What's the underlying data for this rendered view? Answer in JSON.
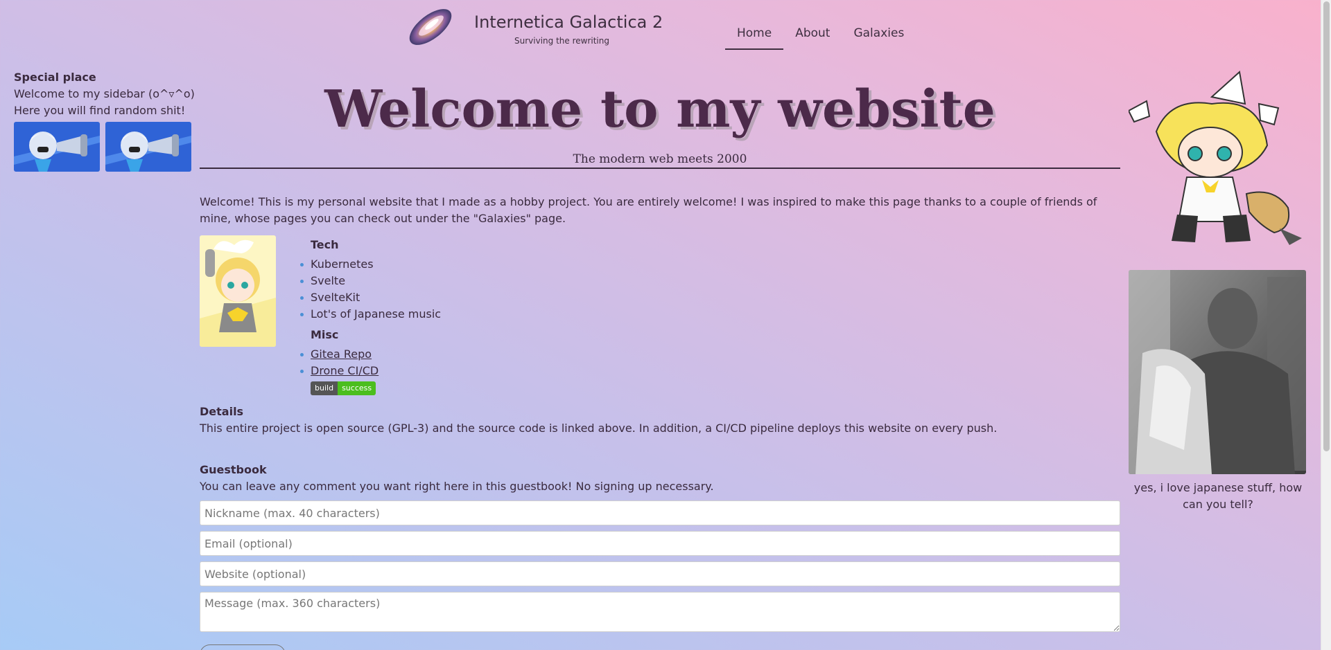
{
  "header": {
    "title": "Internetica Galactica 2",
    "subtitle": "Surviving the rewriting",
    "logo_icon": "galaxy-icon",
    "nav": [
      {
        "label": "Home",
        "active": true
      },
      {
        "label": "About",
        "active": false
      },
      {
        "label": "Galaxies",
        "active": false
      }
    ]
  },
  "left_sidebar": {
    "heading": "Special place",
    "line1": "Welcome to my sidebar (o^▿^o)",
    "line2": "Here you will find random shit!"
  },
  "main": {
    "title": "Welcome to my website",
    "subtitle": "The modern web meets 2000",
    "intro": "Welcome! This is my personal website that I made as a hobby project. You are entirely welcome! I was inspired to make this page thanks to a couple of friends of mine, whose pages you can check out under the \"Galaxies\" page.",
    "tech_title": "Tech",
    "tech_items": [
      "Kubernetes",
      "Svelte",
      "SvelteKit",
      "Lot's of Japanese music"
    ],
    "misc_title": "Misc",
    "misc_links": [
      "Gitea Repo",
      "Drone CI/CD"
    ],
    "badge": {
      "left": "build",
      "right": "success",
      "color": "#4bbe1e"
    },
    "details_title": "Details",
    "details_text": "This entire project is open source (GPL-3) and the source code is linked above. In addition, a CI/CD pipeline deploys this website on every push.",
    "guestbook_title": "Guestbook",
    "guestbook_text": "You can leave any comment you want right here in this guestbook! No signing up necessary.",
    "form": {
      "nickname_placeholder": "Nickname (max. 40 characters)",
      "email_placeholder": "Email (optional)",
      "website_placeholder": "Website (optional)",
      "message_placeholder": "Message (max. 360 characters)"
    }
  },
  "right_sidebar": {
    "caption": "yes, i love japanese stuff, how can you tell?"
  },
  "colors": {
    "accent_text": "#4c2a4a",
    "bullet": "#4a8fd6",
    "gradient_top_right": "#f9b1cc",
    "gradient_bottom_left": "#a7cbf6"
  }
}
